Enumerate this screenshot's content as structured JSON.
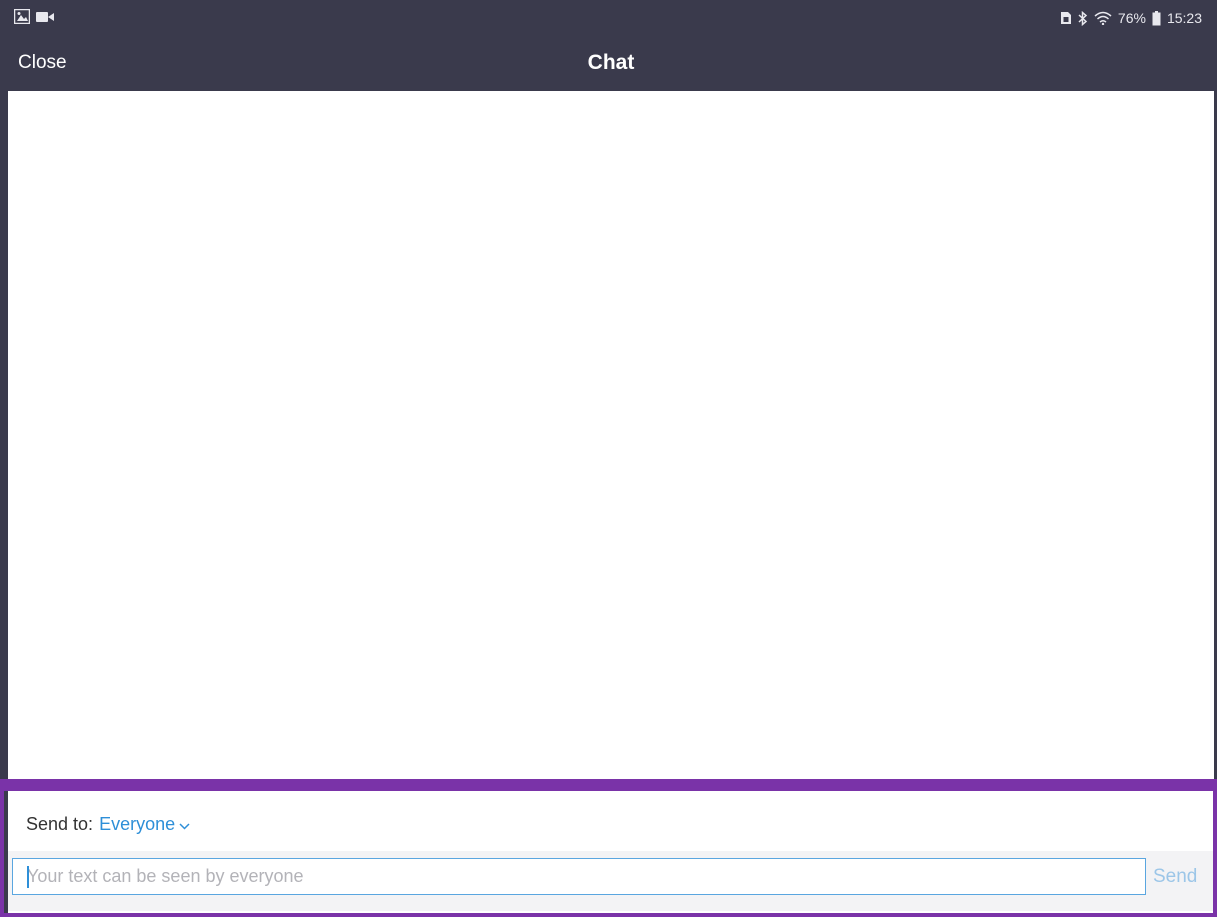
{
  "status_bar": {
    "left_icons": [
      "image-icon",
      "video-camera-icon"
    ],
    "right_icons": [
      "sim-icon",
      "bluetooth-icon",
      "wifi-icon"
    ],
    "battery_percent": "76%",
    "time": "15:23"
  },
  "header": {
    "close_label": "Close",
    "title": "Chat"
  },
  "compose": {
    "send_to_label": "Send to:",
    "recipient": "Everyone",
    "input_placeholder": "Your text can be seen by everyone",
    "input_value": "",
    "send_label": "Send"
  },
  "colors": {
    "header_bg": "#3a3a4c",
    "accent_blue": "#2e8fd8",
    "highlight_purple": "#7a33a8",
    "send_disabled": "#9cc6e8"
  }
}
